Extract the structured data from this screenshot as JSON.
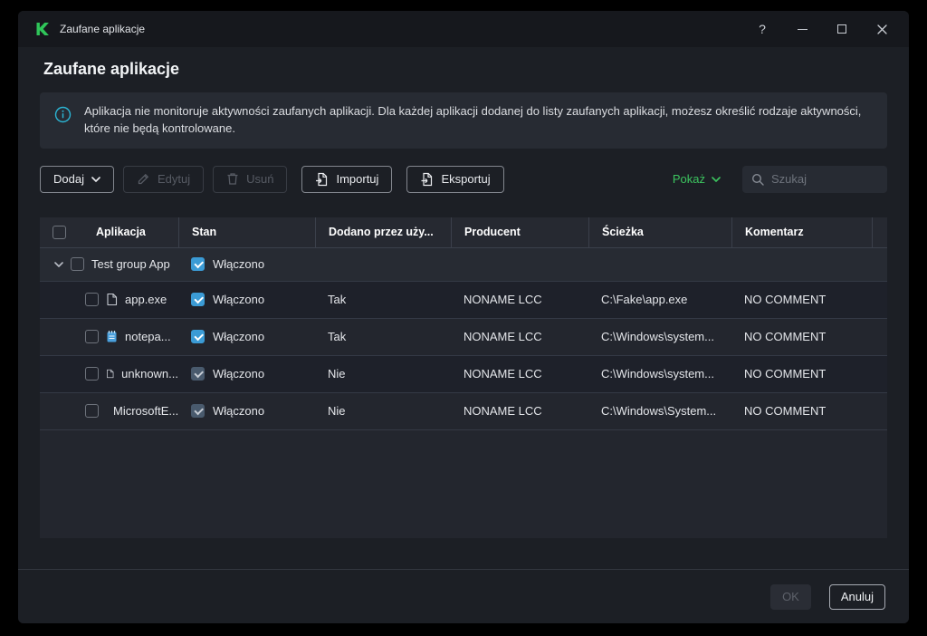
{
  "window": {
    "title": "Zaufane aplikacje",
    "help": "?"
  },
  "page": {
    "heading": "Zaufane aplikacje",
    "info": "Aplikacja nie monitoruje aktywności zaufanych aplikacji. Dla każdej aplikacji dodanej do listy zaufanych aplikacji, możesz określić rodzaje aktywności, które nie będą kontrolowane."
  },
  "toolbar": {
    "add": "Dodaj",
    "edit": "Edytuj",
    "remove": "Usuń",
    "import": "Importuj",
    "export": "Eksportuj",
    "show": "Pokaż",
    "search_placeholder": "Szukaj"
  },
  "table": {
    "columns": [
      "Aplikacja",
      "Stan",
      "Dodano przez uży...",
      "Producent",
      "Ścieżka",
      "Komentarz"
    ],
    "group": {
      "name": "Test group App",
      "state": "Włączono"
    },
    "rows": [
      {
        "name": "app.exe",
        "state": "Włączono",
        "added": "Tak",
        "vendor": "NONAME LCC",
        "path": "C:\\Fake\\app.exe",
        "comment": "NO COMMENT"
      },
      {
        "name": "notepa...",
        "state": "Włączono",
        "added": "Tak",
        "vendor": "NONAME LCC",
        "path": "C:\\Windows\\system...",
        "comment": "NO COMMENT"
      },
      {
        "name": "unknown...",
        "state": "Włączono",
        "added": "Nie",
        "vendor": "NONAME LCC",
        "path": "C:\\Windows\\system...",
        "comment": "NO COMMENT"
      },
      {
        "name": "MicrosoftE...",
        "state": "Włączono",
        "added": "Nie",
        "vendor": "NONAME LCC",
        "path": "C:\\Windows\\System...",
        "comment": "NO COMMENT"
      }
    ]
  },
  "footer": {
    "ok": "OK",
    "cancel": "Anuluj"
  },
  "colors": {
    "accent_green": "#3cc45f",
    "checkbox_blue": "#3b9bd5",
    "checkbox_disabled": "#495a6d",
    "info_cyan": "#2bb5d4",
    "window_bg": "#1c1f25"
  }
}
